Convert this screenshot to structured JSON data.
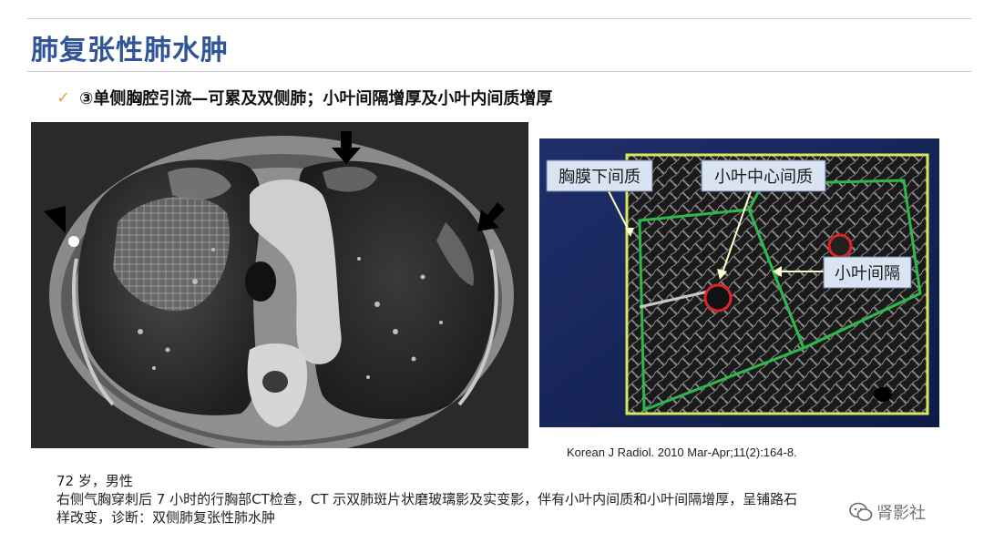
{
  "title": "肺复张性肺水肿",
  "bullet": {
    "icon": "checkmark-icon",
    "text": "③单侧胸腔引流—可累及双侧肺；小叶间隔增厚及小叶内间质增厚"
  },
  "diagram": {
    "labels": {
      "subpleural": "胸膜下间质",
      "centrilobular": "小叶中心间质",
      "septum": "小叶间隔"
    }
  },
  "citation": "Korean J Radiol. 2010 Mar-Apr;11(2):164-8.",
  "caption": {
    "line1": "72 岁，男性",
    "line2": "右侧气胸穿刺后 7 小时的行胸部CT检查，CT 示双肺斑片状磨玻璃影及实变影，伴有小叶内间质和小叶间隔增厚，呈铺路石",
    "line3": "样改变，诊断：双侧肺复张性肺水肿"
  },
  "watermark": {
    "text": "肾影社",
    "icon": "wechat-icon"
  },
  "colors": {
    "title": "#2f5597",
    "check": "#e8a33a",
    "lobule_outline": "#2fb84a",
    "pleura": "#d9e85a"
  }
}
